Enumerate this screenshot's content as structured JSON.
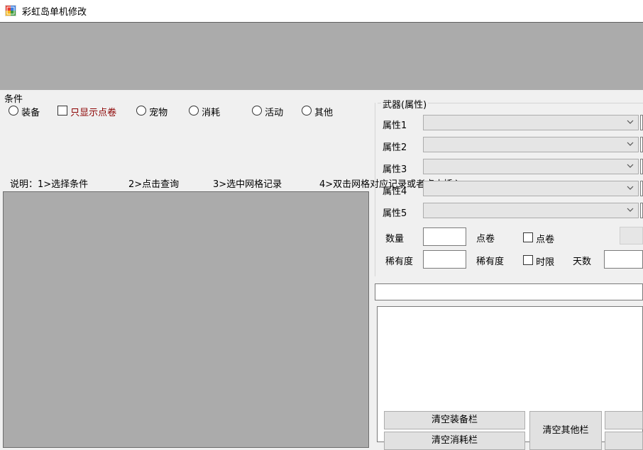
{
  "window": {
    "title": "彩虹岛单机修改"
  },
  "conditions": {
    "label": "条件",
    "options": [
      {
        "label": "装备",
        "type": "radio"
      },
      {
        "label": "只显示点卷",
        "type": "checkbox",
        "color": "#8b0000"
      },
      {
        "label": "宠物",
        "type": "radio"
      },
      {
        "label": "消耗",
        "type": "radio"
      },
      {
        "label": "活动",
        "type": "radio"
      },
      {
        "label": "其他",
        "type": "radio"
      }
    ]
  },
  "instructions": {
    "step1": "说明：1>选择条件",
    "step2": "2>点击查询",
    "step3": "3>选中网格记录",
    "step4": "4>双击网格对应记录或者点击插入"
  },
  "weapon": {
    "group_label": "武器(属性)",
    "attributes": [
      "属性1",
      "属性2",
      "属性3",
      "属性4",
      "属性5"
    ],
    "quantity_label": "数量",
    "dianjuan_label": "点卷",
    "dianjuan_check": "点卷",
    "rarity_label": "稀有度",
    "rarity_label2": "稀有度",
    "time_limit_check": "时限",
    "days_label": "天数"
  },
  "buttons": {
    "clear_equip": "清空装备栏",
    "clear_other": "清空其他栏",
    "clear_consume": "清空消耗栏"
  }
}
